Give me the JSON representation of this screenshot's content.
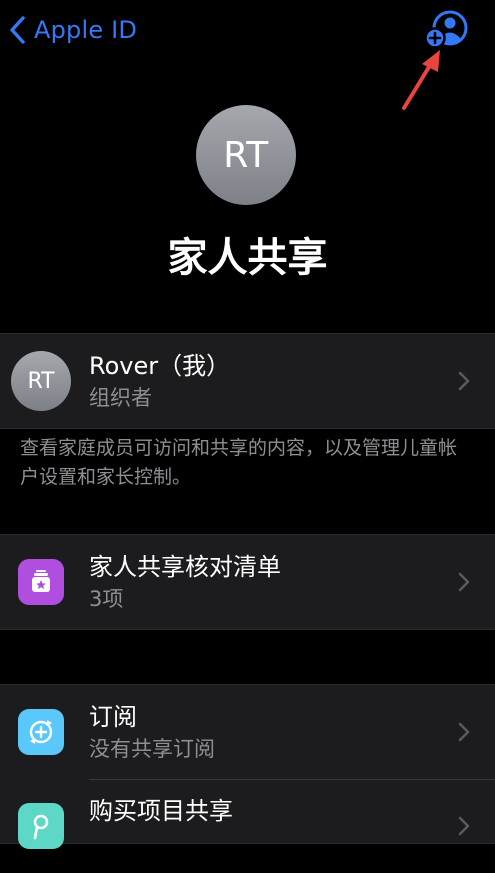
{
  "nav": {
    "back_label": "Apple ID"
  },
  "header": {
    "avatar_initials": "RT",
    "title": "家人共享"
  },
  "organizer": {
    "avatar_initials": "RT",
    "name": "Rover（我）",
    "role": "组织者"
  },
  "footnote": "查看家庭成员可访问和共享的内容，以及管理儿童帐户设置和家长控制。",
  "checklist": {
    "title": "家人共享核对清单",
    "count": "3项"
  },
  "services": [
    {
      "title": "订阅",
      "subtitle": "没有共享订阅"
    },
    {
      "title": "购买项目共享",
      "subtitle": ""
    }
  ],
  "colors": {
    "accent": "#3478F6",
    "background": "#000000",
    "cell": "#1c1c1e",
    "secondary_text": "#8e8e93",
    "checklist_icon": "#B04EE0",
    "subscription_icon": "#5AC8FA",
    "purchase_icon": "#5DD8C6",
    "annotation_arrow": "#E8453C"
  },
  "icons": {
    "back": "chevron-left-icon",
    "add_member": "person-add-icon",
    "checklist": "checklist-icon",
    "subscription": "subscription-icon",
    "purchase": "purchase-sharing-icon",
    "disclosure": "chevron-right-icon"
  }
}
